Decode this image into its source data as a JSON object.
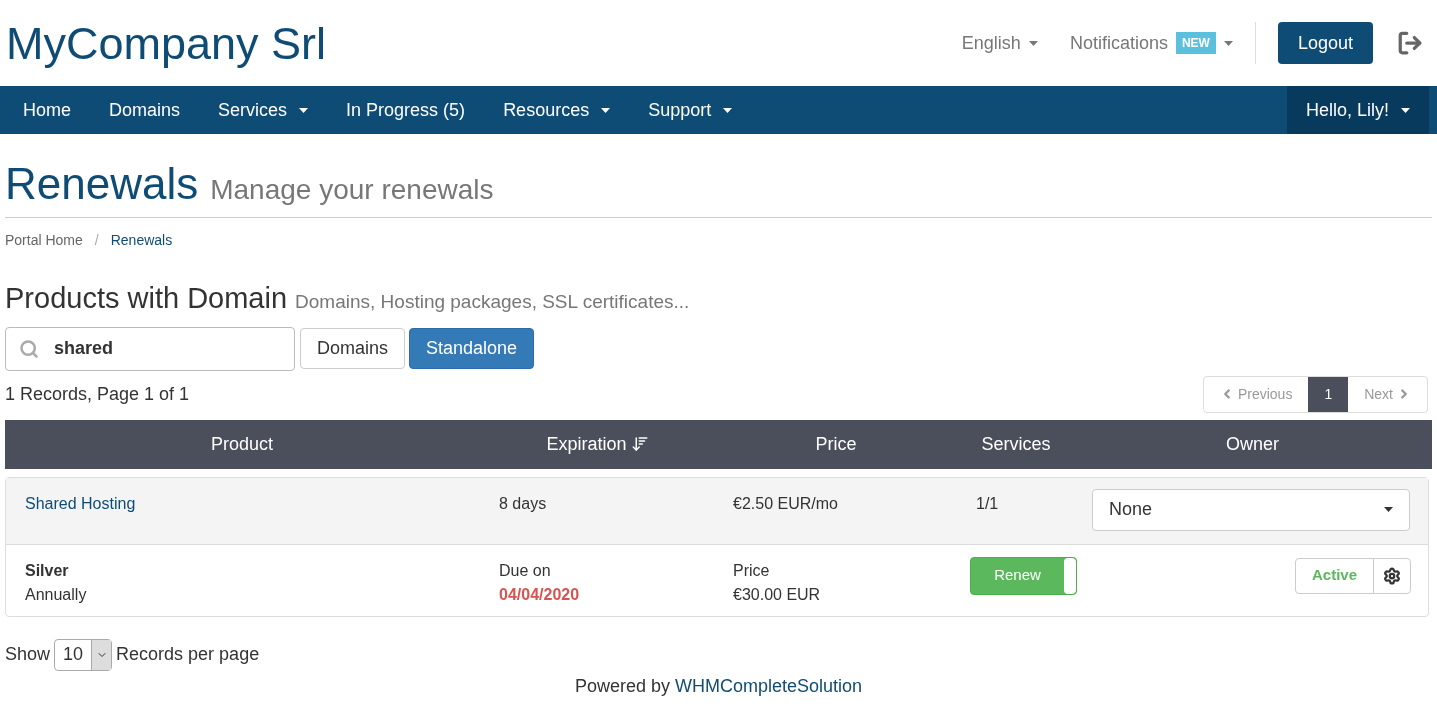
{
  "header": {
    "brand": "MyCompany Srl",
    "language": "English",
    "notifications": {
      "label": "Notifications",
      "badge": "NEW"
    },
    "logout": "Logout"
  },
  "nav": {
    "items": [
      {
        "label": "Home",
        "dropdown": false
      },
      {
        "label": "Domains",
        "dropdown": false
      },
      {
        "label": "Services",
        "dropdown": true
      },
      {
        "label": "In Progress (5)",
        "dropdown": false
      },
      {
        "label": "Resources",
        "dropdown": true
      },
      {
        "label": "Support",
        "dropdown": true
      }
    ],
    "user": "Hello, Lily!"
  },
  "page": {
    "title": "Renewals",
    "subtitle": "Manage your renewals"
  },
  "breadcrumb_separator": "/",
  "breadcrumb": [
    {
      "label": "Portal Home",
      "selected": false
    },
    {
      "label": "Renewals",
      "selected": true
    }
  ],
  "section": {
    "title": "Products with Domain",
    "subtitle": "Domains, Hosting packages, SSL certificates..."
  },
  "search": {
    "value": "shared"
  },
  "filters": [
    {
      "label": "Domains",
      "selected": false
    },
    {
      "label": "Standalone",
      "selected": true
    }
  ],
  "records_summary": "1 Records, Page 1 of 1",
  "pagination": {
    "previous": "Previous",
    "pages": [
      {
        "label": "1",
        "selected": true
      }
    ],
    "next": "Next"
  },
  "table": {
    "columns": [
      {
        "label": "Product",
        "sorted": false
      },
      {
        "label": "Expiration",
        "sorted": true
      },
      {
        "label": "Price",
        "sorted": false
      },
      {
        "label": "Services",
        "sorted": false
      },
      {
        "label": "Owner",
        "sorted": false
      }
    ],
    "groups": [
      {
        "product": "Shared Hosting",
        "expiration": "8 days",
        "price": "€2.50 EUR/mo",
        "services": "1/1",
        "owner": "None",
        "items": [
          {
            "name": "Silver",
            "cycle": "Annually",
            "due_label": "Due on",
            "due_date": "04/04/2020",
            "overdue": true,
            "price_label": "Price",
            "price": "€30.00 EUR",
            "renew": {
              "label": "Renew",
              "on": true
            },
            "status": "Active"
          }
        ]
      }
    ]
  },
  "page_size": {
    "prefix": "Show",
    "value": "10",
    "suffix": "Records per page"
  },
  "footer": {
    "text": "Powered by",
    "link": "WHMCompleteSolution"
  }
}
